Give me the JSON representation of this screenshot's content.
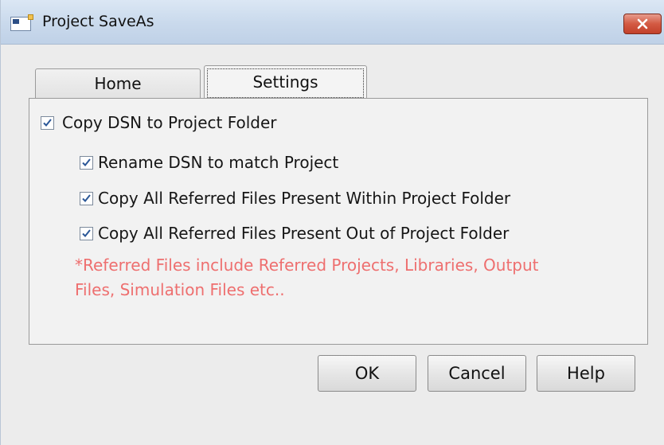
{
  "window": {
    "title": "Project SaveAs",
    "icons": {
      "app": "project-window-icon",
      "close": "close-icon"
    }
  },
  "tabs": [
    {
      "label": "Home",
      "selected": false
    },
    {
      "label": "Settings",
      "selected": true
    }
  ],
  "settings": {
    "copy_dsn": {
      "label": "Copy DSN to Project Folder",
      "checked": true
    },
    "rename_dsn": {
      "label": "Rename DSN to match Project",
      "checked": true
    },
    "copy_within": {
      "label": "Copy All Referred Files Present Within Project Folder",
      "checked": true
    },
    "copy_out": {
      "label": "Copy All Referred Files Present Out of Project Folder",
      "checked": true
    },
    "note_line1": "*Referred Files include Referred Projects, Libraries, Output",
    "note_line2": "Files, Simulation Files etc.."
  },
  "buttons": {
    "ok": "OK",
    "cancel": "Cancel",
    "help": "Help"
  },
  "colors": {
    "note": "#ee6f6f",
    "close_button": "#c9452e",
    "checkmark": "#2b5797"
  }
}
